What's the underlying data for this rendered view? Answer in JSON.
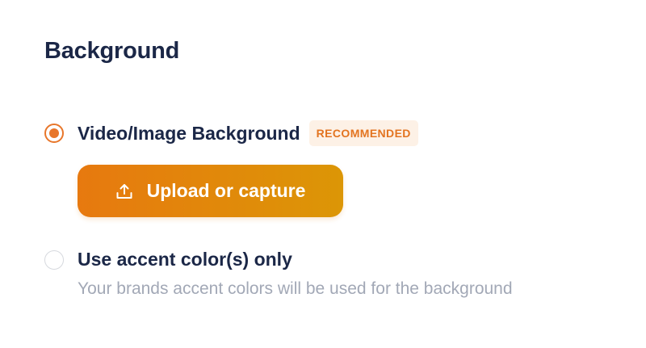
{
  "section": {
    "title": "Background"
  },
  "options": [
    {
      "label": "Video/Image Background",
      "selected": true,
      "badge": "RECOMMENDED"
    },
    {
      "label": "Use accent color(s) only",
      "selected": false,
      "helper": "Your brands accent colors will be used for the background"
    }
  ],
  "upload": {
    "label": "Upload or capture",
    "icon": "upload-icon"
  },
  "colors": {
    "accent": "#e8762a",
    "button_gradient_start": "#e7790f",
    "button_gradient_end": "#dc9606",
    "badge_bg": "#fdf1e6",
    "title_text": "#1b2747",
    "helper_text": "#a2a8b6"
  }
}
